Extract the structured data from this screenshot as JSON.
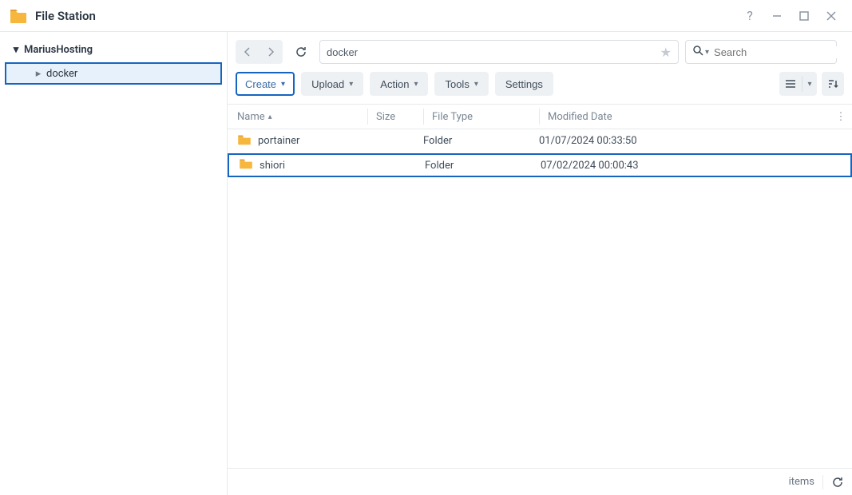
{
  "app": {
    "title": "File Station"
  },
  "window_controls": {
    "help_icon": "help-icon",
    "minimize_icon": "minimize-icon",
    "maximize_icon": "maximize-icon",
    "close_icon": "close-icon"
  },
  "sidebar": {
    "root_label": "MariusHosting",
    "selected_label": "docker"
  },
  "path": {
    "value": "docker"
  },
  "search": {
    "placeholder": "Search"
  },
  "toolbar": {
    "create_label": "Create",
    "upload_label": "Upload",
    "action_label": "Action",
    "tools_label": "Tools",
    "settings_label": "Settings"
  },
  "columns": {
    "name": "Name",
    "size": "Size",
    "type": "File Type",
    "modified": "Modified Date"
  },
  "rows": [
    {
      "name": "portainer",
      "size": "",
      "type": "Folder",
      "modified": "01/07/2024 00:33:50",
      "highlight": false
    },
    {
      "name": "shiori",
      "size": "",
      "type": "Folder",
      "modified": "07/02/2024 00:00:43",
      "highlight": true
    }
  ],
  "status": {
    "items_label": "items"
  }
}
